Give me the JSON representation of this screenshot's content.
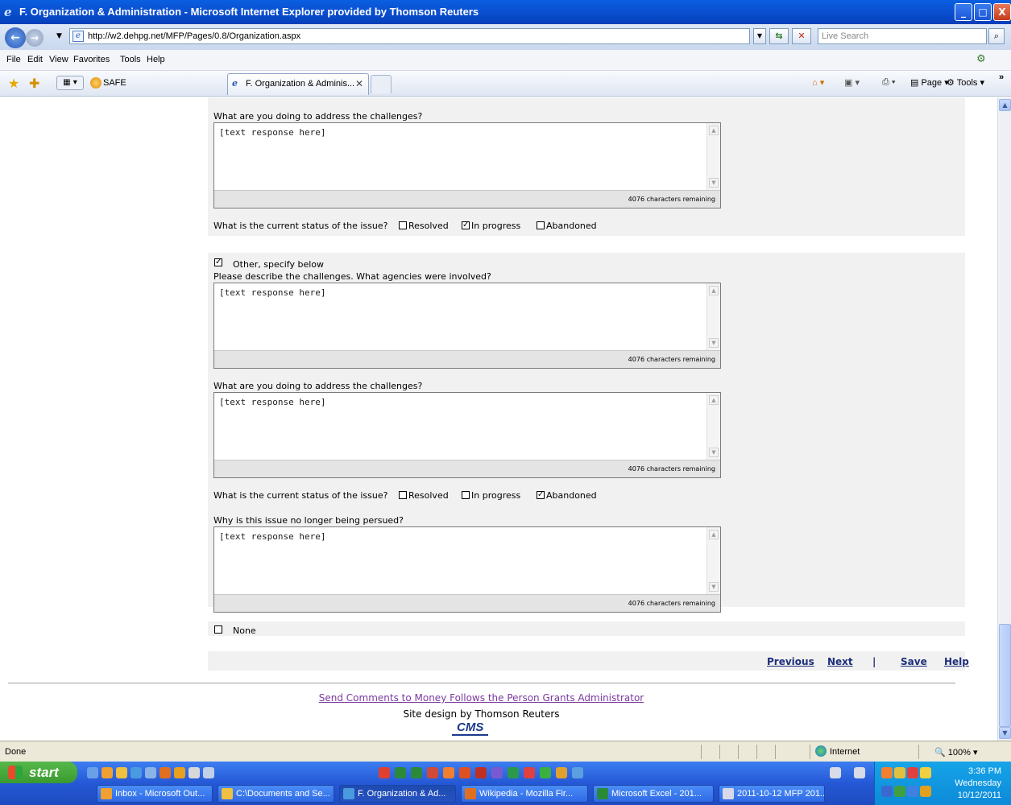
{
  "window": {
    "title": "F. Organization & Administration - Microsoft Internet Explorer provided by Thomson Reuters",
    "minimize": "_",
    "maximize": "□",
    "close": "X"
  },
  "address": {
    "url": "http://w2.dehpg.net/MFP/Pages/0.8/Organization.aspx",
    "search_placeholder": "Live Search"
  },
  "menu": [
    "File",
    "Edit",
    "View",
    "Favorites",
    "Tools",
    "Help"
  ],
  "favorites": {
    "item": "SAFE"
  },
  "tab": {
    "label": "F. Organization & Adminis..."
  },
  "commands": {
    "page": "Page",
    "tools": "Tools"
  },
  "form": {
    "q_address_1": "What are you doing to address the challenges?",
    "response_placeholder": "[text response here]",
    "remaining": "4076 characters remaining",
    "status_q": "What is the current status of the issue?",
    "opt_resolved": "Resolved",
    "opt_in_progress": "In progress",
    "opt_abandoned": "Abandoned",
    "other_label": "Other, specify below",
    "describe_q": "Please describe the challenges. What agencies were involved?",
    "q_address_2": "What are you doing to address the challenges?",
    "why_q": "Why is this issue no longer being persued?",
    "none_label": "None",
    "status1": {
      "resolved": false,
      "in_progress": true,
      "abandoned": false
    },
    "other_checked": true,
    "status2": {
      "resolved": false,
      "in_progress": false,
      "abandoned": true
    },
    "none_checked": false
  },
  "nav": {
    "previous": "Previous",
    "next": "Next",
    "separator": "|",
    "save": "Save",
    "help": "Help"
  },
  "footer": {
    "send_comments": "Send Comments to Money Follows the Person Grants Administrator",
    "site_design": "Site design by Thomson Reuters",
    "logo": "CMS"
  },
  "status": {
    "text": "Done",
    "zone": "Internet",
    "zoom": "100%"
  },
  "taskbar": {
    "start": "start",
    "items": [
      "Inbox - Microsoft Out...",
      "C:\\Documents and Se...",
      "F. Organization & Ad...",
      "Wikipedia - Mozilla Fir...",
      "Microsoft Excel - 201...",
      "2011-10-12 MFP 201..."
    ],
    "time": "3:36 PM",
    "day": "Wednesday",
    "date": "10/12/2011"
  }
}
